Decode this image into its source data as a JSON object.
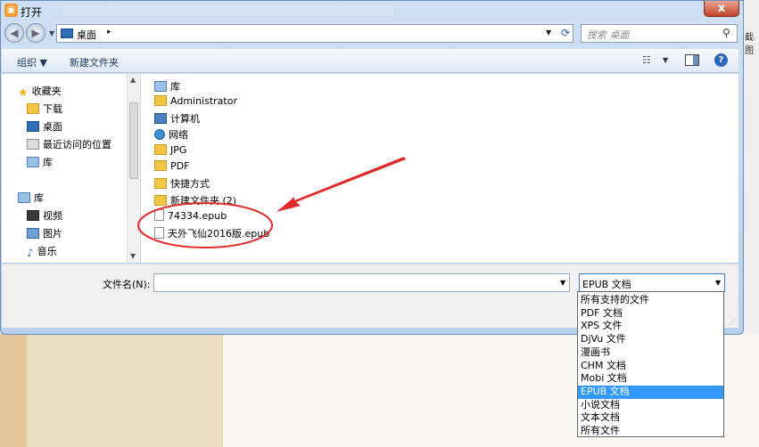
{
  "window": {
    "title": "打开",
    "close_label": "x"
  },
  "address_bar": {
    "current": "桌面",
    "separator": "▸",
    "search_placeholder": "搜索 桌面"
  },
  "toolbar": {
    "organize_label": "组织 ▼",
    "new_folder_label": "新建文件夹"
  },
  "nav_pane": {
    "favorites_header": "收藏夹",
    "favorites": [
      "下载",
      "桌面",
      "最近访问的位置",
      "库"
    ],
    "libraries_header": "库",
    "libraries": [
      "视频",
      "图片",
      "音乐"
    ]
  },
  "files": [
    {
      "name": "库",
      "icon": "library-icon"
    },
    {
      "name": "Administrator",
      "icon": "user-folder-icon"
    },
    {
      "name": "计算机",
      "icon": "computer-icon"
    },
    {
      "name": "网络",
      "icon": "network-icon"
    },
    {
      "name": "JPG",
      "icon": "folder-icon"
    },
    {
      "name": "PDF",
      "icon": "folder-icon"
    },
    {
      "name": "快捷方式",
      "icon": "folder-icon"
    },
    {
      "name": "新建文件夹 (2)",
      "icon": "folder-icon"
    },
    {
      "name": "74334.epub",
      "icon": "file-icon"
    },
    {
      "name": "天外飞仙2016版.epub",
      "icon": "file-icon"
    }
  ],
  "bottom": {
    "filename_label": "文件名(N):",
    "filename_value": "",
    "file_type_selected": "EPUB 文档"
  },
  "file_types": [
    "所有支持的文件",
    "PDF 文档",
    "XPS 文件",
    "DjVu 文件",
    "漫画书",
    "CHM 文档",
    "Mobi 文档",
    "EPUB 文档",
    "小说文档",
    "文本文档",
    "所有文件"
  ],
  "file_types_selected_index": 7,
  "colors": {
    "annotation": "#e32a2a",
    "selection": "#3399ff"
  },
  "background_text": "截图"
}
